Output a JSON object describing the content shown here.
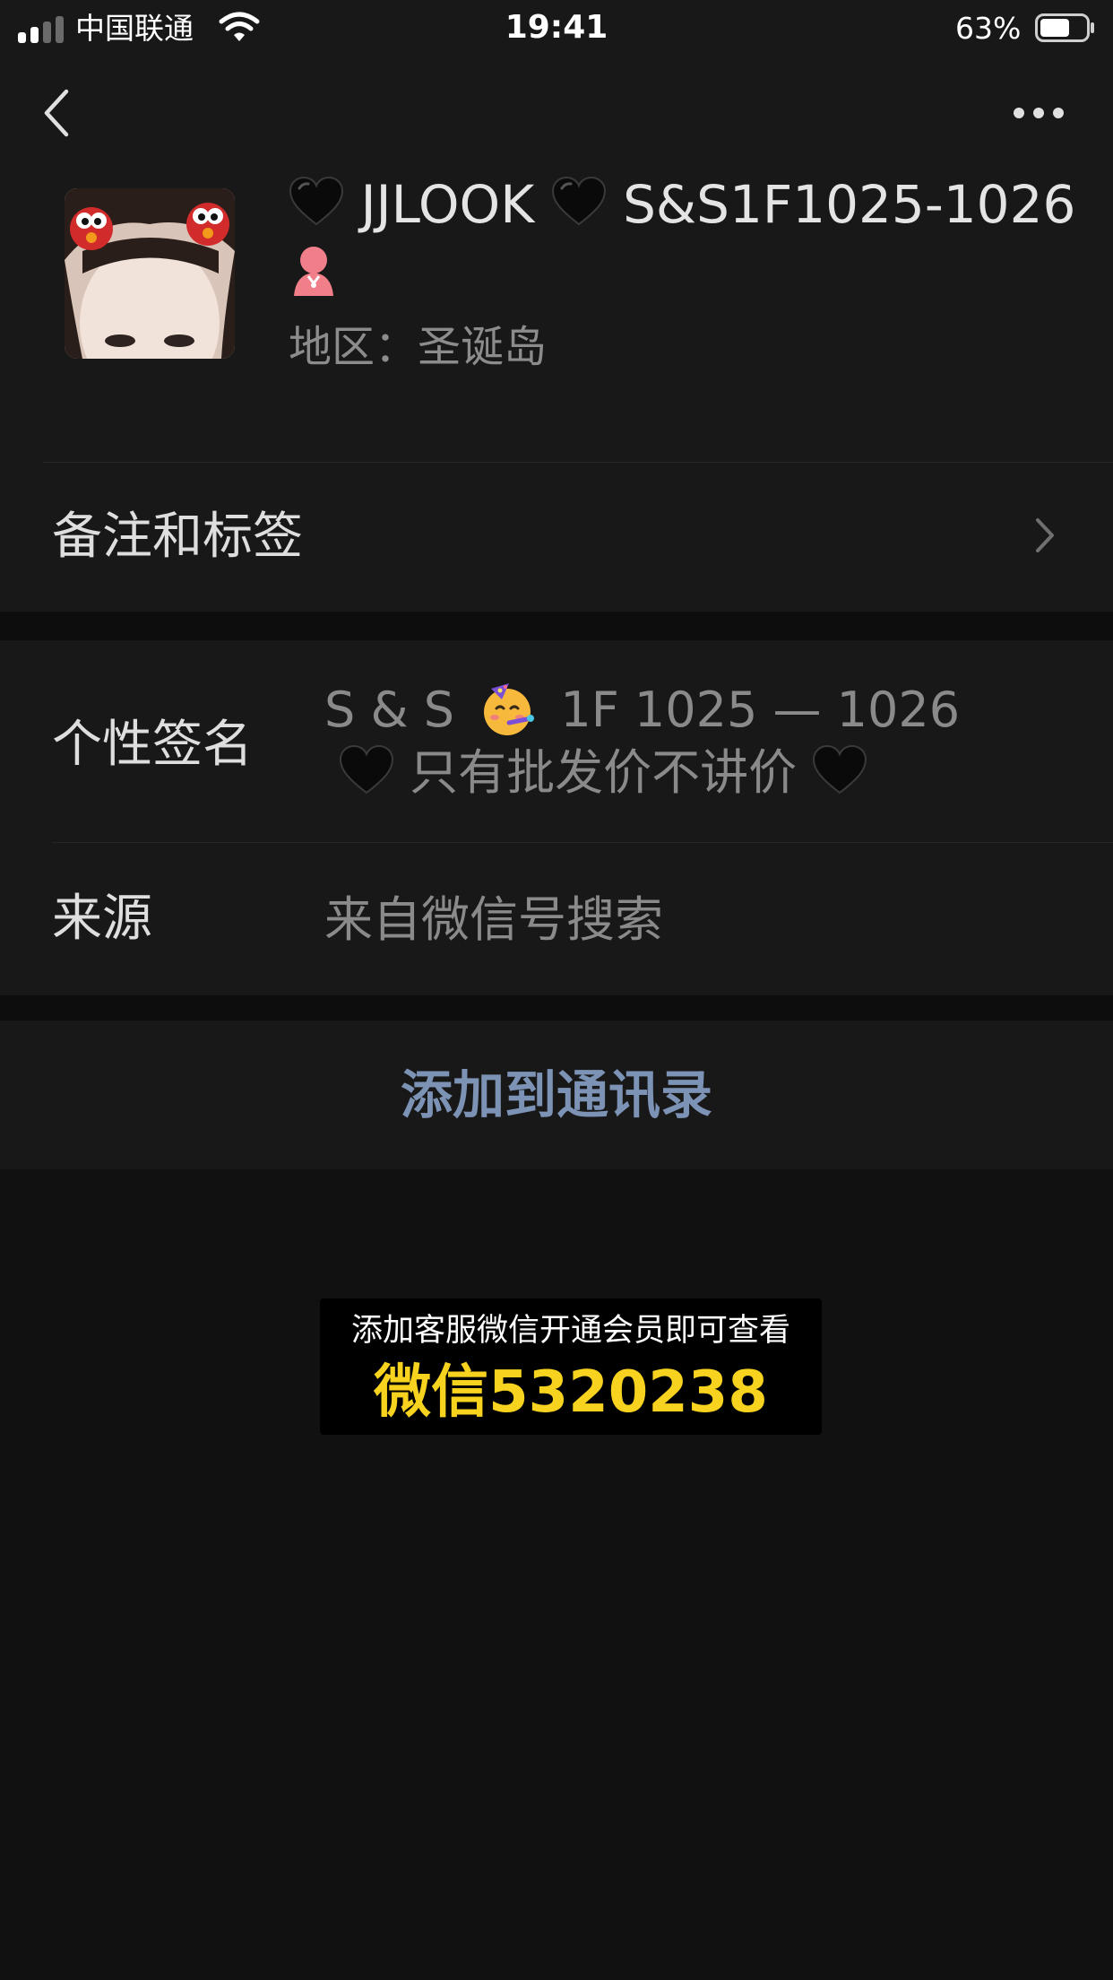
{
  "status_bar": {
    "carrier": "中国联通",
    "time": "19:41",
    "battery_percent": "63%",
    "battery_level": 0.63,
    "signal_bars": 2
  },
  "nav": {
    "back_icon": "chevron-left-icon",
    "more_icon": "ellipsis-icon"
  },
  "profile": {
    "avatar_icon": "avatar-photo",
    "nickname_part1": "JJLOOK",
    "nickname_part2": "S&S1F1025-1026",
    "nickname_icons": [
      "black-heart-icon",
      "black-heart-icon",
      "girl-emoji-icon"
    ],
    "region": "地区：圣诞岛"
  },
  "rows": {
    "remark_label": "备注和标签",
    "signature_label": "个性签名",
    "signature_line1_a": "S & S",
    "signature_line1_b": "1F 1025 — 1026",
    "signature_line2": "只有批发价不讲价",
    "signature_icons": [
      "party-face-emoji",
      "black-heart-icon"
    ],
    "source_label": "来源",
    "source_value": "来自微信号搜索"
  },
  "actions": {
    "add_contact": "添加到通讯录"
  },
  "promo": {
    "line1": "添加客服微信开通会员即可查看",
    "line2": "微信5320238"
  },
  "colors": {
    "background": "#111111",
    "card": "#181818",
    "link_blue": "#7c93b6",
    "promo_yellow": "#f7d21e"
  }
}
